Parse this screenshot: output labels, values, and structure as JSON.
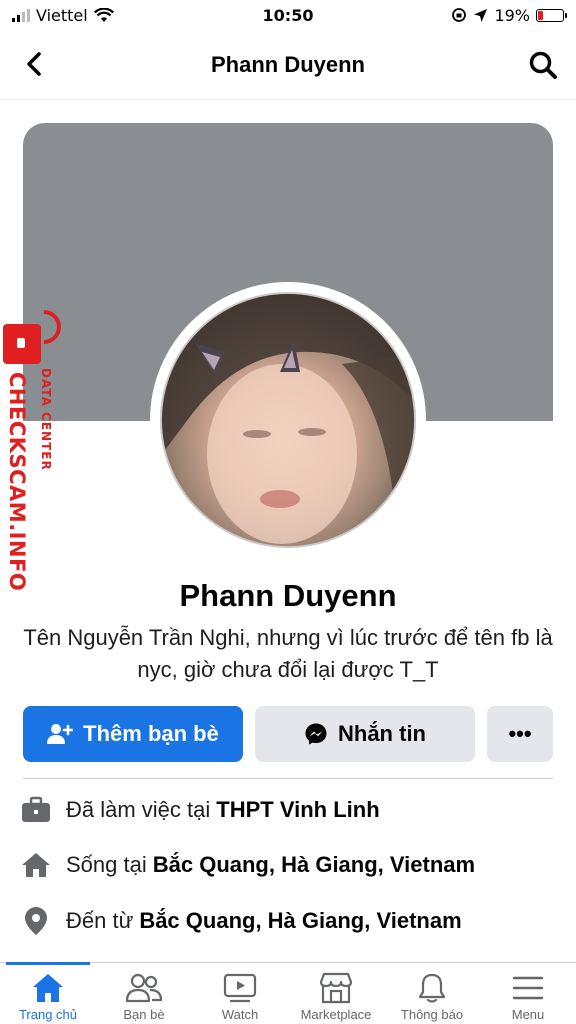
{
  "status_bar": {
    "carrier": "Viettel",
    "time": "10:50",
    "battery_percent": "19%",
    "battery_level": 0.19,
    "battery_color": "#e41e1e"
  },
  "header": {
    "title": "Phann Duyenn",
    "back_icon": "chevron-left-icon",
    "search_icon": "search-icon"
  },
  "watermark": {
    "brand": "CHECKSCAM.INFO",
    "sub": "DATA CENTER",
    "color": "#e02020"
  },
  "profile": {
    "name": "Phann Duyenn",
    "bio": "Tên Nguyễn Trần Nghi, nhưng vì lúc trước để tên fb là nyc, giờ chưa đổi lại được T_T",
    "cover_color": "#8a8d91"
  },
  "actions": {
    "add_friend_label": "Thêm bạn bè",
    "message_label": "Nhắn tin",
    "more_label": "•••",
    "primary_color": "#1b74e4"
  },
  "details": [
    {
      "icon": "briefcase-icon",
      "prefix": "Đã làm việc tại",
      "value": "THPT Vinh Linh"
    },
    {
      "icon": "home-icon",
      "prefix": "Sống tại",
      "value": "Bắc Quang, Hà Giang, Vietnam"
    },
    {
      "icon": "location-pin-icon",
      "prefix": "Đến từ",
      "value": "Bắc Quang, Hà Giang, Vietnam"
    }
  ],
  "tabs": [
    {
      "label": "Trang chủ",
      "icon": "home-icon",
      "active": true
    },
    {
      "label": "Bạn bè",
      "icon": "friends-icon",
      "active": false
    },
    {
      "label": "Watch",
      "icon": "watch-icon",
      "active": false
    },
    {
      "label": "Marketplace",
      "icon": "marketplace-icon",
      "active": false
    },
    {
      "label": "Thông báo",
      "icon": "bell-icon",
      "active": false
    },
    {
      "label": "Menu",
      "icon": "menu-icon",
      "active": false
    }
  ]
}
